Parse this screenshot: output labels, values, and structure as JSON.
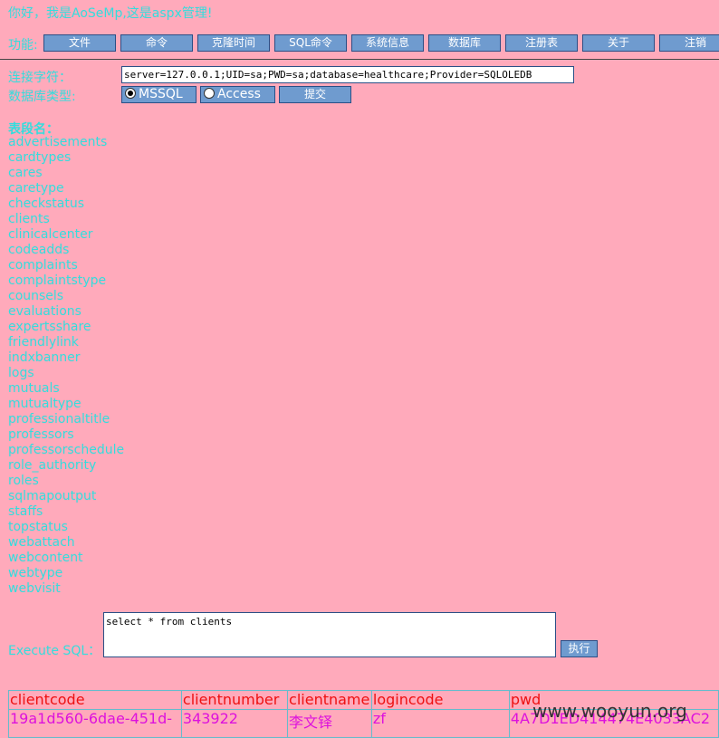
{
  "greeting": "你好，我是AoSeMp,这是aspx管理!",
  "menu": {
    "label": "功能:",
    "items": [
      "文件",
      "命令",
      "克隆时间",
      "SQL命令",
      "系统信息",
      "数据库",
      "注册表",
      "关于",
      "注销"
    ]
  },
  "connection": {
    "label": "连接字符：",
    "value": "server=127.0.0.1;UID=sa;PWD=sa;database=healthcare;Provider=SQLOLEDB"
  },
  "db_type": {
    "label": "数据库类型:",
    "options": [
      {
        "label": "MSSQL",
        "checked": true
      },
      {
        "label": "Access",
        "checked": false
      }
    ],
    "submit_label": "提交"
  },
  "tables": {
    "title": "表段名：",
    "items": [
      "advertisements",
      "cardtypes",
      "cares",
      "caretype",
      "checkstatus",
      "clients",
      "clinicalcenter",
      "codeadds",
      "complaints",
      "complaintstype",
      "counsels",
      "evaluations",
      "expertsshare",
      "friendlylink",
      "indxbanner",
      "logs",
      "mutuals",
      "mutualtype",
      "professionaltitle",
      "professors",
      "professorschedule",
      "role_authority",
      "roles",
      "sqlmapoutput",
      "staffs",
      "topstatus",
      "webattach",
      "webcontent",
      "webtype",
      "webvisit"
    ]
  },
  "sql": {
    "label": "Execute SQL：",
    "query": "select * from clients",
    "exec_label": "执行"
  },
  "results": {
    "columns": [
      "clientcode",
      "clientnumber",
      "clientname",
      "logincode",
      "pwd"
    ],
    "rows": [
      [
        "19a1d560-6dae-451d-",
        "343922",
        "李文铎",
        "zf",
        "4A7D1ED414474E4033AC2"
      ]
    ]
  },
  "watermark": "www.wooyun.org"
}
